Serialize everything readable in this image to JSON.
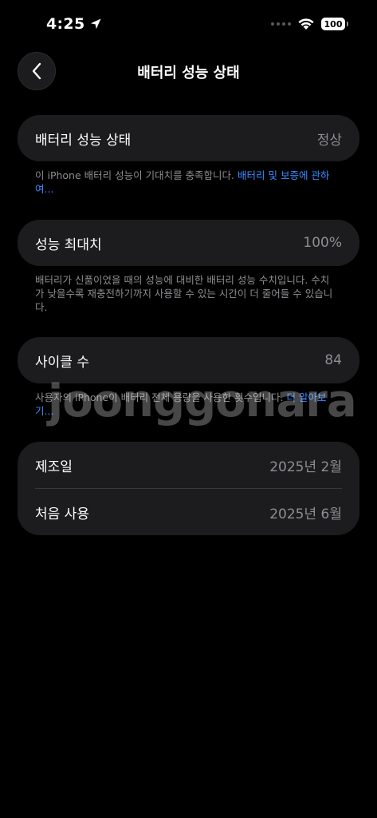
{
  "status_bar": {
    "time": "4:25",
    "battery_level": "100"
  },
  "nav": {
    "title": "배터리 성능 상태"
  },
  "sections": {
    "health": {
      "label": "배터리 성능 상태",
      "value": "정상",
      "note": "이 iPhone 배터리 성능이 기대치를 충족합니다. ",
      "link": "배터리 및 보증에 관하여..."
    },
    "max_capacity": {
      "label": "성능 최대치",
      "value": "100%",
      "note": "배터리가 신품이었을 때의 성능에 대비한 배터리 성능 수치입니다. 수치가 낮을수록 재충전하기까지 사용할 수 있는 시간이 더 줄어들 수 있습니다."
    },
    "cycle_count": {
      "label": "사이클 수",
      "value": "84",
      "note": "사용자의 iPhone이 배터리 전체 용량을 사용한 횟수입니다. ",
      "link": "더 알아보기..."
    },
    "dates": {
      "manufacture_label": "제조일",
      "manufacture_value": "2025년 2월",
      "first_use_label": "처음 사용",
      "first_use_value": "2025년 6월"
    }
  },
  "watermark": "joonggonara",
  "colors": {
    "background": "#000000",
    "card": "#1c1c1e",
    "secondary_text": "#8e8e93",
    "link": "#3a8bff"
  }
}
